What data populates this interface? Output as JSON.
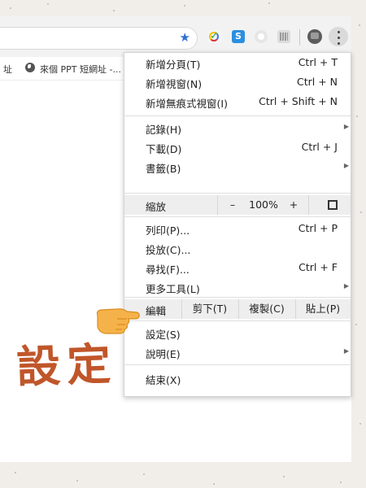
{
  "omnibox": {
    "star_icon": "star-icon"
  },
  "bookmarks": {
    "partial_left": "址",
    "item_1": "來個 PPT 短網址 -..."
  },
  "menu": {
    "new_tab": {
      "label": "新增分頁(T)",
      "shortcut": "Ctrl + T"
    },
    "new_window": {
      "label": "新增視窗(N)",
      "shortcut": "Ctrl + N"
    },
    "new_incognito": {
      "label": "新增無痕式視窗(I)",
      "shortcut": "Ctrl + Shift + N"
    },
    "history": {
      "label": "記錄(H)"
    },
    "downloads": {
      "label": "下載(D)",
      "shortcut": "Ctrl + J"
    },
    "bookmarks": {
      "label": "書籤(B)"
    },
    "zoom": {
      "label": "縮放",
      "minus": "–",
      "value": "100%",
      "plus": "+"
    },
    "print": {
      "label": "列印(P)...",
      "shortcut": "Ctrl + P"
    },
    "cast": {
      "label": "投放(C)..."
    },
    "find": {
      "label": "尋找(F)...",
      "shortcut": "Ctrl + F"
    },
    "more_tools": {
      "label": "更多工具(L)"
    },
    "edit": {
      "label": "編輯",
      "cut": "剪下(T)",
      "copy": "複製(C)",
      "paste": "貼上(P)"
    },
    "settings": {
      "label": "設定(S)"
    },
    "help": {
      "label": "說明(E)"
    },
    "exit": {
      "label": "結束(X)"
    }
  },
  "annotation": {
    "text": "設定"
  },
  "colors": {
    "accent": "#2f6fd0",
    "handwriting": "#c0562a",
    "hand": "#f6b24a"
  }
}
